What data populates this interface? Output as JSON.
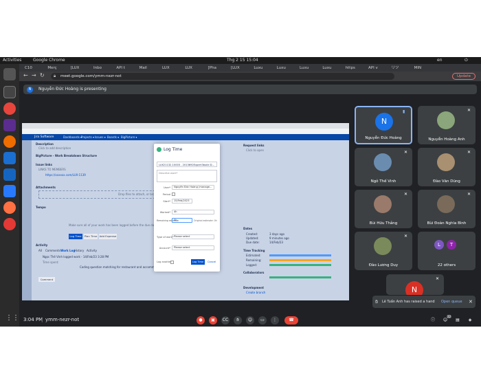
{
  "os": {
    "activities": "Activities",
    "app_name": "Google Chrome",
    "clock": "Thg 2 15  15:04",
    "lang": "en"
  },
  "browser": {
    "tabs": [
      "C10",
      "Merç",
      "[LUX",
      "Inbo",
      "API t",
      "Mail",
      "LUX",
      "LUX",
      "[Pha",
      "[LUX",
      "Luxu",
      "Luxu",
      "Luxu",
      "Luxu",
      "https",
      "API v",
      "リツ",
      "MIN"
    ],
    "url": "meet.google.com/ymm-nezr-not",
    "update_label": "Update"
  },
  "meet": {
    "presenting": "Nguyễn Đức Hoàng is presenting",
    "time": "3:04 PM",
    "meeting_code": "ymm-nezr-not",
    "participants": [
      {
        "name": "Nguyễn Đức Hoàng",
        "initial": "N",
        "color": "#1a73e8"
      },
      {
        "name": "Nguyễn Hoàng Anh",
        "initial": "",
        "color": "#8aa67a"
      },
      {
        "name": "Ngô Thế Vinh",
        "initial": "",
        "color": "#6a8caf"
      },
      {
        "name": "Đào Văn Dũng",
        "initial": "",
        "color": "#a89070"
      },
      {
        "name": "Bùi Hữu Thắng",
        "initial": "",
        "color": "#9a7a6a"
      },
      {
        "name": "Bùi Đoàn Nghĩa Bình",
        "initial": "",
        "color": "#7a6a5a"
      },
      {
        "name": "Đào Lương Duy",
        "initial": "",
        "color": "#7a8a5a"
      },
      {
        "name": "22 others",
        "initial": "LT",
        "color": "#3c4043"
      }
    ],
    "extra_tile_initial": "N",
    "badge_count": "22",
    "toast_text": "Lê Tuấn Anh has raised a hand",
    "toast_action": "Open queue"
  },
  "jira": {
    "logo": "Jira Software",
    "nav": [
      "Dashboards ▾",
      "Projects ▾",
      "Issues ▾",
      "Boards ▾",
      "BigPicture ▾"
    ],
    "description_label": "Description",
    "description_hint": "Click to add description",
    "bigpicture_label": "BigPicture - Work Breakdown Structure",
    "issuelinks_label": "Issue links",
    "links_to": "LINKS TO MEMBERS",
    "link_item": "https://xxxxxx.com/LUX-1139",
    "attachments_label": "Attachments",
    "drop_hint": "Drop files to attach, or browse.",
    "tempo_label": "Tempo",
    "tempo_hint": "Make sure all of your work has been logged before the due date.",
    "log_time_btn": "Log Time",
    "plan_time_btn": "Plan Time",
    "add_expense_btn": "Add Expense",
    "activity_label": "Activity",
    "activity_tabs": [
      "All",
      "Comments",
      "Work Log",
      "History",
      "Activity"
    ],
    "worklog_user": "Ngọc Thế Vinh logged work - 14/Feb/23 3:28 PM",
    "time_spent": "Time spent:",
    "worklog_note": "Coding question matching for restaurant and accommodation.jpg",
    "comment_btn": "Comment",
    "request_link": "Request links",
    "request_hint": "Click to open",
    "dates_label": "Dates",
    "dates": [
      [
        "Created:",
        "3 days ago"
      ],
      [
        "Updated:",
        "9 minutes ago"
      ],
      [
        "Due date:",
        "14/Feb/23"
      ]
    ],
    "timetracking_label": "Time Tracking",
    "tt_rows": [
      "Estimated:",
      "Remaining:",
      "Logged:"
    ],
    "collab_label": "Collaborators",
    "development_label": "Development",
    "create_branch": "Create branch"
  },
  "modal": {
    "title": "Log Time",
    "issue": "LUX21132-10003 - 2013692Expert3build D...",
    "description_ph": "Describe work*",
    "user_label": "User*",
    "user_value": "Nguyễn Đức Hoàng (manage...",
    "period_label": "Period",
    "start_label": "Start*",
    "start_value": "15/Feb/2023",
    "worked_label": "Worked*",
    "worked_value": "4h",
    "remaining_label": "Remaining estimate",
    "remaining_value": "0h",
    "original_est": "Original estimate: 0h",
    "type_label": "Type of work*",
    "type_value": "Please select",
    "account_label": "Account*",
    "account_value": "Please select",
    "log_another": "Log another",
    "log_btn": "Log Time",
    "cancel_btn": "Cancel"
  }
}
